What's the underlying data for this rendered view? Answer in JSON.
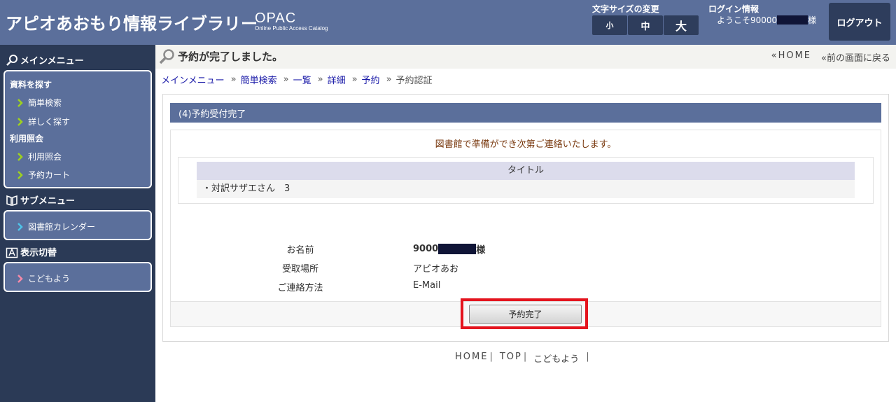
{
  "header": {
    "site_title": "アピオあおもり情報ライブラリー",
    "opac_main": "OPAC",
    "opac_sub": "Online Public Access Catalog",
    "font_size_label": "文字サイズの変更",
    "font_small": "小",
    "font_medium": "中",
    "font_large": "大",
    "login_label": "ログイン情報",
    "welcome_prefix": "ようこそ90000",
    "welcome_suffix": "様",
    "logout": "ログアウト"
  },
  "sidebar": {
    "main_menu": "メインメニュー",
    "group_search": "資料を探す",
    "simple_search": "簡単検索",
    "detail_search": "詳しく探す",
    "group_usage": "利用照会",
    "usage_inquiry": "利用照会",
    "reserve_cart": "予約カート",
    "sub_menu": "サブメニュー",
    "calendar": "図書館カレンダー",
    "display_switch": "表示切替",
    "kids": "こどもよう"
  },
  "title_bar": {
    "title": "予約が完了しました。",
    "home_link": "HOME",
    "back_link": "前の画面に戻る"
  },
  "breadcrumb": {
    "main_menu": "メインメニュー",
    "simple_search": "簡単検索",
    "list": "一覧",
    "detail": "詳細",
    "reserve": "予約",
    "current": "予約認証"
  },
  "content": {
    "section_title": "(4)予約受付完了",
    "notice": "図書館で準備ができ次第ご連絡いたします。",
    "table_header": "タイトル",
    "title_row": "・対訳サザエさん　3",
    "name_label": "お名前",
    "name_prefix": "9000",
    "name_suffix": "様",
    "pickup_label": "受取場所",
    "pickup_value": "アピオあお",
    "contact_label": "ご連絡方法",
    "contact_value": "E-Mail",
    "complete_button": "予約完了"
  },
  "footer": {
    "home": "HOME",
    "top": "TOP",
    "kids": "こどもよう",
    "sep": "|"
  },
  "colors": {
    "header_bg": "#5b6f9b",
    "sidebar_bg": "#2b3a56",
    "highlight": "#e4141e",
    "notice_text": "#7a3a10",
    "link": "#1a1aa8"
  }
}
